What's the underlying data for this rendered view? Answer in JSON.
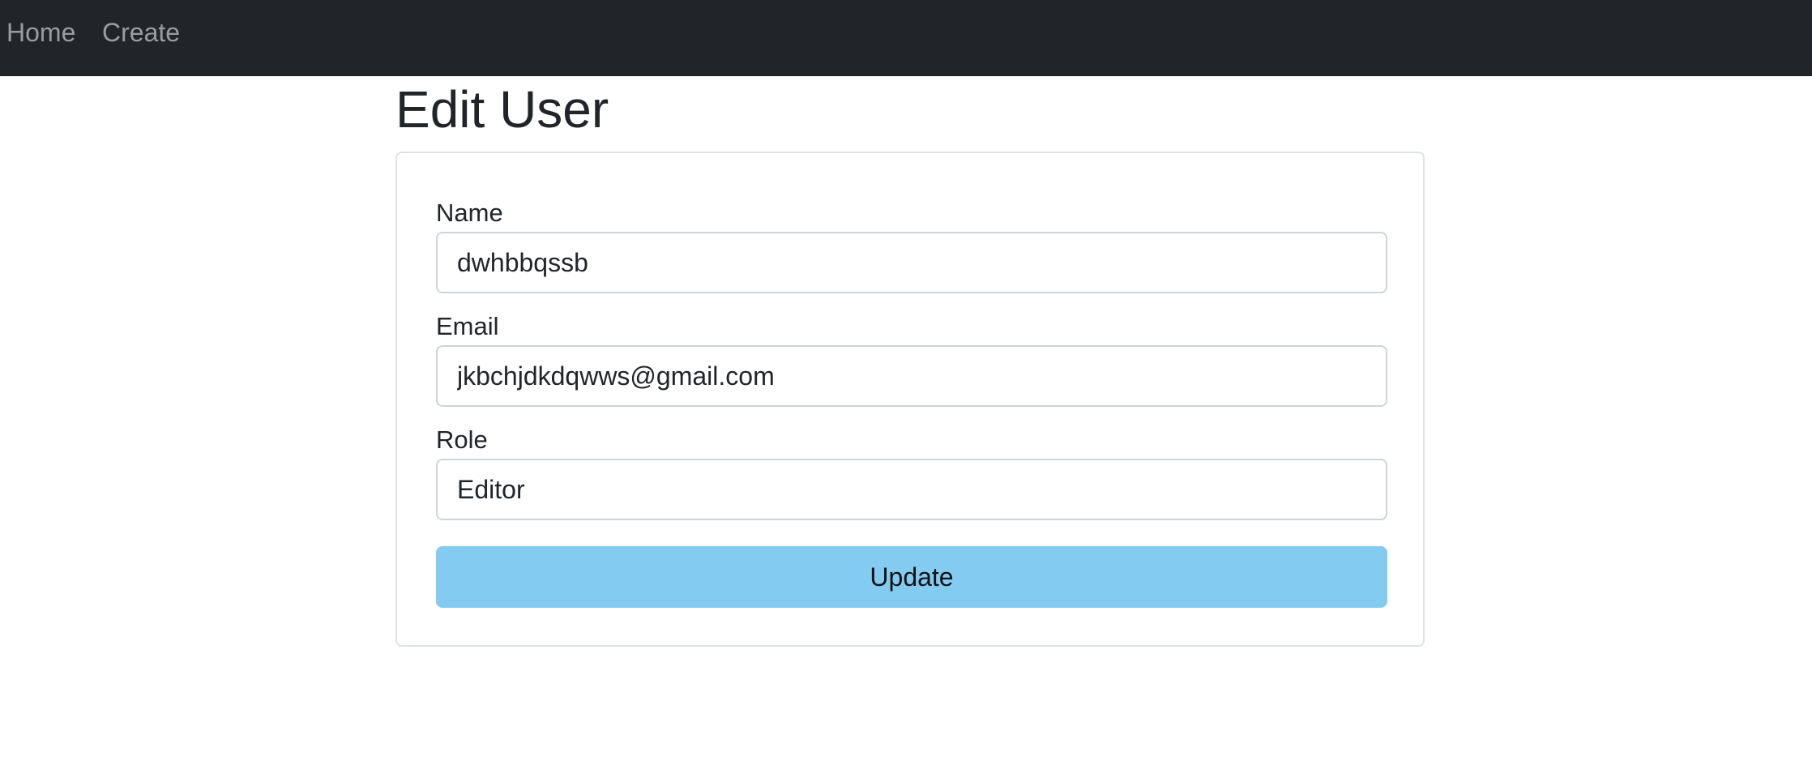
{
  "nav": {
    "home_label": "Home",
    "create_label": "Create"
  },
  "page": {
    "title": "Edit User"
  },
  "form": {
    "name": {
      "label": "Name",
      "value": "dwhbbqssb"
    },
    "email": {
      "label": "Email",
      "value": "jkbchjdkdqwws@gmail.com"
    },
    "role": {
      "label": "Role",
      "value": "Editor"
    },
    "submit_label": "Update"
  },
  "colors": {
    "navbar_bg": "#212529",
    "button_bg": "#84cbf2"
  }
}
